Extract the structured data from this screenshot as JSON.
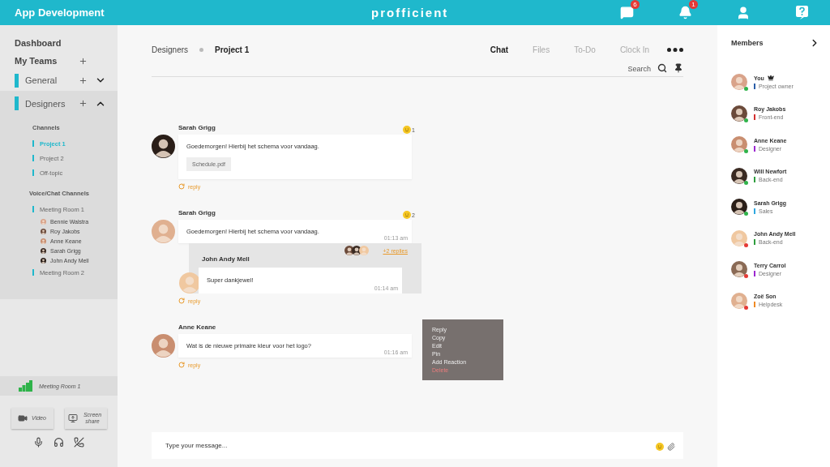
{
  "header": {
    "title": "App Development",
    "logo": "profficient",
    "icons": [
      {
        "kind": "chat",
        "badge": "6"
      },
      {
        "kind": "bell",
        "badge": "1"
      },
      {
        "kind": "user"
      },
      {
        "kind": "help"
      }
    ]
  },
  "sidebar": {
    "dashboard": "Dashboard",
    "my_teams": "My Teams",
    "teams": [
      {
        "name": "General",
        "expanded": false
      },
      {
        "name": "Designers",
        "expanded": true
      }
    ],
    "channels_heading": "Channels",
    "channels": [
      {
        "name": "Project 1",
        "selected": true
      },
      {
        "name": "Project 2",
        "selected": false
      },
      {
        "name": "Off-topic",
        "selected": false
      }
    ],
    "voice_heading": "Voice/Chat Channels",
    "voice_rooms": [
      {
        "name": "Meeting Room 1",
        "participants": [
          "Bennie Walstra",
          "Roy Jakobs",
          "Anne Keane",
          "Sarah Grigg",
          "John Andy Mell"
        ]
      },
      {
        "name": "Meeting Room 2"
      }
    ],
    "call": {
      "room": "Meeting Room 1",
      "buttons": [
        {
          "kind": "video",
          "label": "Video"
        },
        {
          "kind": "screen",
          "label": "Screen share"
        }
      ]
    }
  },
  "main": {
    "breadcrumb": [
      "Designers",
      "Project 1"
    ],
    "tabs": [
      {
        "label": "Chat",
        "selected": true
      },
      {
        "label": "Files",
        "selected": false
      },
      {
        "label": "To-Do",
        "selected": false
      },
      {
        "label": "Clock In",
        "selected": false
      }
    ],
    "search": "Search",
    "messages": [
      {
        "author": "Sarah Grigg",
        "text": "Goedemorgen! Hierbij het schema voor vandaag.",
        "attachment": "Schedule.pdf",
        "reactions": "1",
        "reply": "reply"
      },
      {
        "author": "Sarah Grigg",
        "text": "Goedemorgen! Hierbij het schema voor vandaag.",
        "time": "01:13 am",
        "reactions": "2",
        "reply": "reply",
        "thread": {
          "author": "John Andy Mell",
          "text": "Super dankjewel!",
          "time": "01:14 am",
          "more": "+2 replies"
        }
      },
      {
        "author": "Anne Keane",
        "text": "Wat is de nieuwe primaire kleur voor het logo?",
        "time": "01:16 am",
        "reply": "reply"
      }
    ],
    "context_menu": [
      {
        "label": "Reply",
        "kind": "normal"
      },
      {
        "label": "Copy",
        "kind": "normal"
      },
      {
        "label": "Edit",
        "kind": "normal"
      },
      {
        "label": "Pin",
        "kind": "normal"
      },
      {
        "label": "Add Reaction",
        "kind": "normal"
      },
      {
        "label": "Delete",
        "kind": "danger"
      }
    ],
    "composer": {
      "placeholder": "Type your message..."
    }
  },
  "members": {
    "title": "Members",
    "list": [
      {
        "name": "You",
        "owner": true,
        "role": "Project owner",
        "color": "#2a5ea8",
        "online": true
      },
      {
        "name": "Roy Jakobs",
        "owner": false,
        "role": "Front-end",
        "color": "#d32f2f",
        "online": true
      },
      {
        "name": "Anne Keane",
        "owner": false,
        "role": "Designer",
        "color": "#9c27d0",
        "online": true
      },
      {
        "name": "Will Newfort",
        "owner": false,
        "role": "Back-end",
        "color": "#2e9e3e",
        "online": true
      },
      {
        "name": "Sarah Grigg",
        "owner": false,
        "role": "Sales",
        "color": "#2fa8e0",
        "online": true
      },
      {
        "name": "John Andy Mell",
        "owner": false,
        "role": "Back-end",
        "color": "#2e9e3e",
        "online": false
      },
      {
        "name": "Terry Carrol",
        "owner": false,
        "role": "Designer",
        "color": "#9c27d0",
        "online": false
      },
      {
        "name": "Zoë Son",
        "owner": false,
        "role": "Helpdesk",
        "color": "#f08a24",
        "online": false
      }
    ]
  }
}
